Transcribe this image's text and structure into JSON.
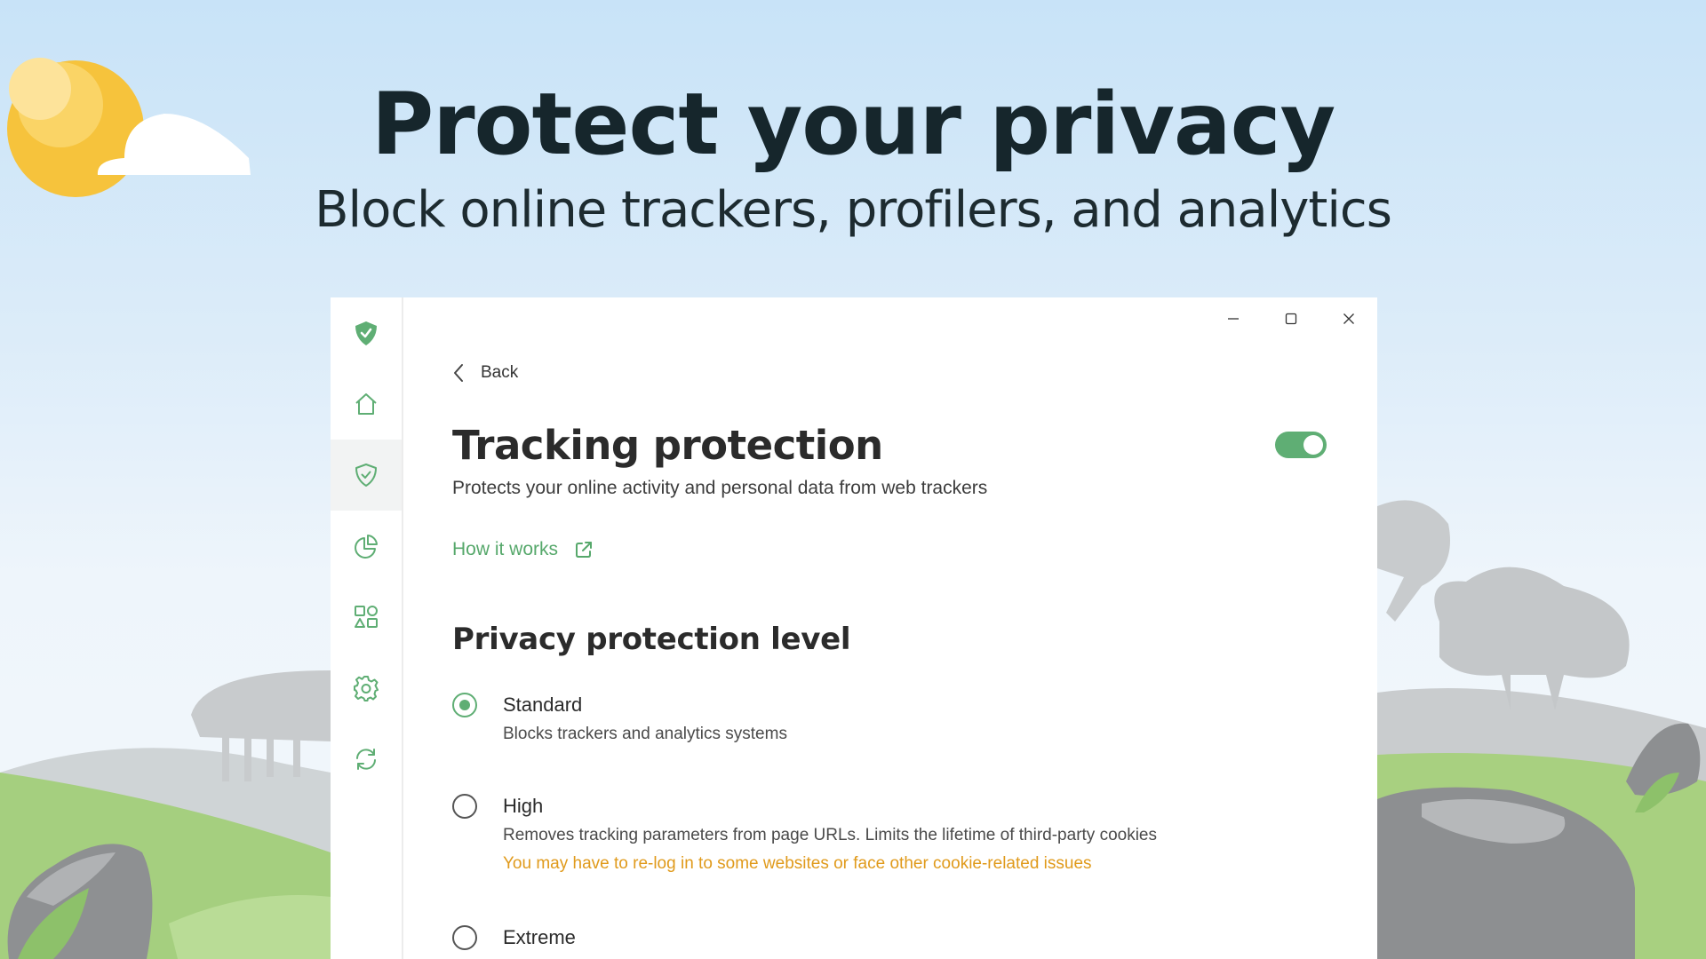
{
  "hero": {
    "title": "Protect your privacy",
    "subtitle": "Block online trackers, profilers, and analytics"
  },
  "sidebar": {
    "items": [
      {
        "icon": "adguard-shield-logo-icon",
        "active": false
      },
      {
        "icon": "home-icon",
        "active": false
      },
      {
        "icon": "shield-check-icon",
        "active": true
      },
      {
        "icon": "pie-chart-icon",
        "active": false
      },
      {
        "icon": "apps-grid-icon",
        "active": false
      },
      {
        "icon": "gear-icon",
        "active": false
      },
      {
        "icon": "sync-icon",
        "active": false
      }
    ]
  },
  "window_controls": {
    "minimize": "minimize-icon",
    "maximize": "maximize-icon",
    "close": "close-icon"
  },
  "main": {
    "back_label": "Back",
    "title": "Tracking protection",
    "description": "Protects your online activity and personal data from web trackers",
    "toggle_on": true,
    "how_it_works": "How it works",
    "section_title": "Privacy protection level",
    "options": [
      {
        "label": "Standard",
        "description": "Blocks trackers and analytics systems",
        "warning": "",
        "selected": true
      },
      {
        "label": "High",
        "description": "Removes tracking parameters from page URLs. Limits the lifetime of third-party cookies",
        "warning": "You may have to re-log in to some websites or face other cookie-related issues",
        "selected": false
      },
      {
        "label": "Extreme",
        "description": "",
        "warning": "",
        "selected": false
      }
    ]
  },
  "colors": {
    "accent": "#5fae74",
    "warning": "#e09a1b",
    "title": "#16262c"
  }
}
